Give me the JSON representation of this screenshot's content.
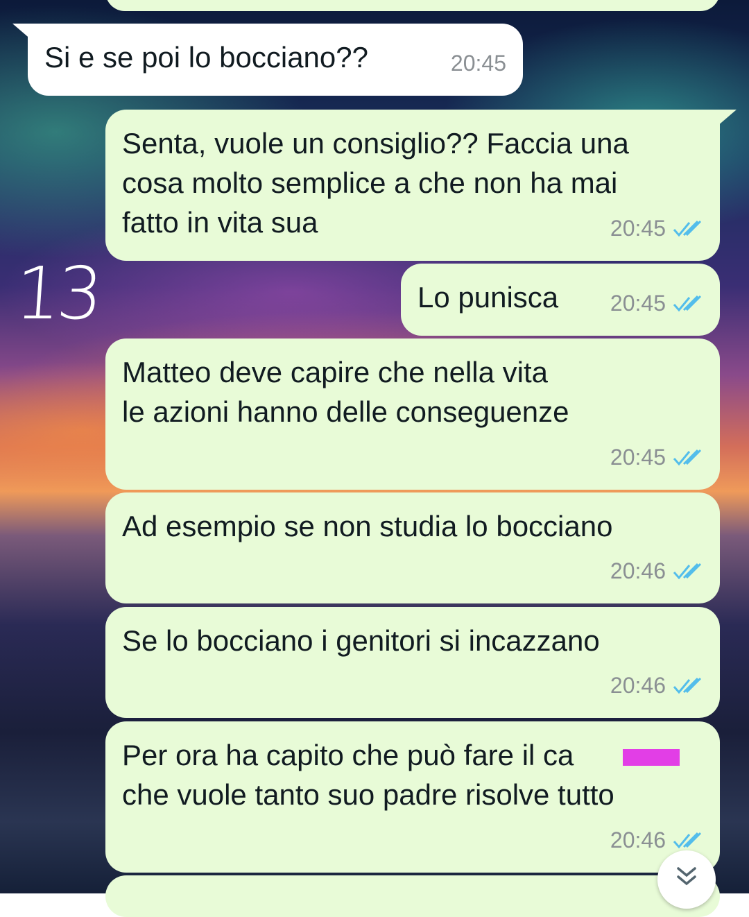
{
  "annotation": "13",
  "messages": [
    {
      "dir": "in",
      "text": "Si e se poi lo bocciano??",
      "time": "20:45"
    },
    {
      "dir": "out",
      "text": "Senta, vuole un consiglio?? Faccia una\ncosa molto semplice a che non ha mai\nfatto in vita sua",
      "time": "20:45"
    },
    {
      "dir": "out",
      "text": "Lo punisca",
      "time": "20:45"
    },
    {
      "dir": "out",
      "text": "Matteo deve capire che nella vita\nle azioni hanno delle conseguenze",
      "time": "20:45"
    },
    {
      "dir": "out",
      "text": "Ad esempio se non studia lo bocciano",
      "time": "20:46"
    },
    {
      "dir": "out",
      "text": "Se lo bocciano i genitori si incazzano",
      "time": "20:46"
    },
    {
      "dir": "out",
      "text": "Per ora ha capito che può fare il ca\nche vuole tanto suo padre risolve tutto",
      "time": "20:46"
    }
  ],
  "colors": {
    "outgoing_bubble": "#e8fbd7",
    "incoming_bubble": "#ffffff",
    "read_ticks": "#53bdeb",
    "redaction": "#e23ee6"
  },
  "icons": {
    "read_receipt": "double-check-icon",
    "scroll_down": "chevron-double-down-icon"
  }
}
